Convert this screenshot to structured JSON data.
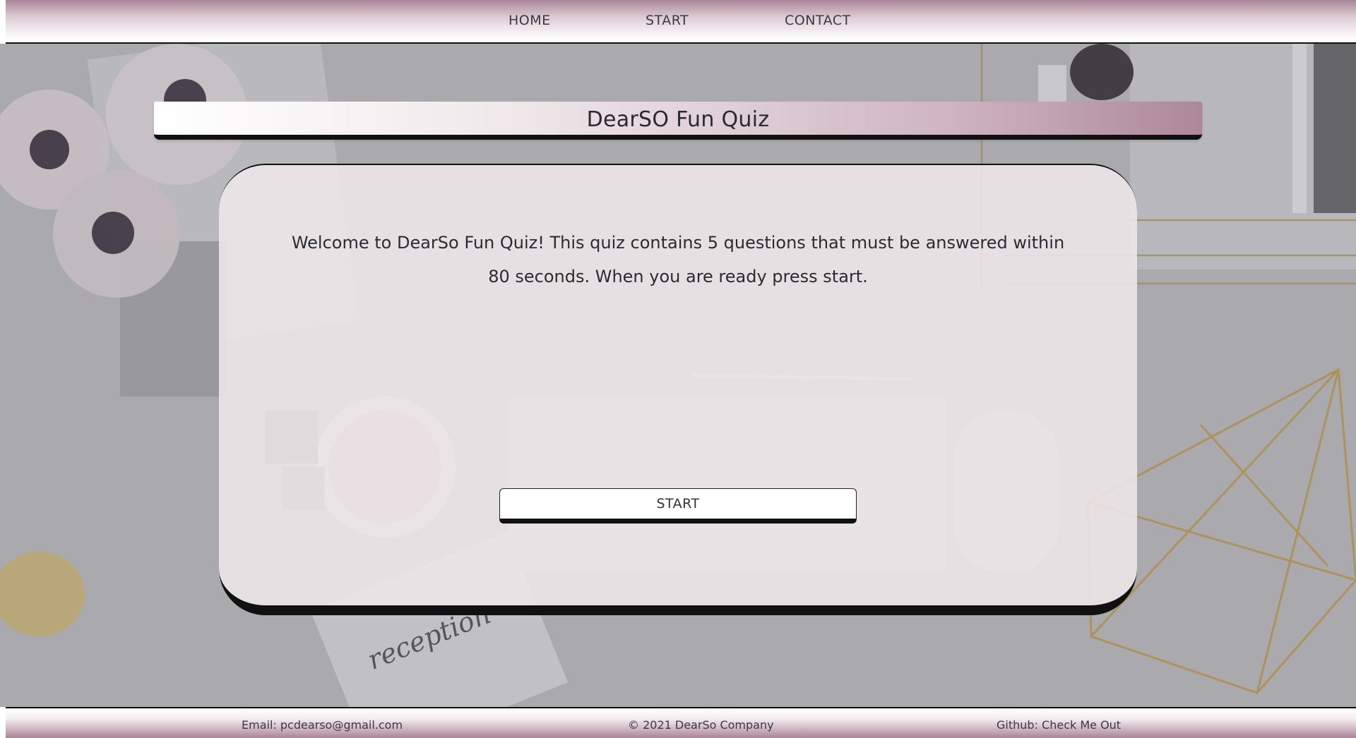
{
  "nav": {
    "items": [
      {
        "label": "HOME"
      },
      {
        "label": "START"
      },
      {
        "label": "CONTACT"
      }
    ]
  },
  "quiz": {
    "title": "DearSO Fun Quiz",
    "welcome_text": "Welcome to DearSo Fun Quiz! This quiz contains 5 questions that must be answered within 80 seconds. When you are ready press start.",
    "start_label": "START"
  },
  "footer": {
    "email": "Email: pcdearso@gmail.com",
    "copyright": "© 2021 DearSo Company",
    "github": "Github: Check Me Out"
  },
  "theme": {
    "accent": "#a98597",
    "dark_border": "#111111",
    "card_bg": "#eee7eb"
  },
  "background": {
    "scene": "desk flat-lay with flowers, keyboard, coffee cup, notebooks, gold wire ornaments"
  }
}
